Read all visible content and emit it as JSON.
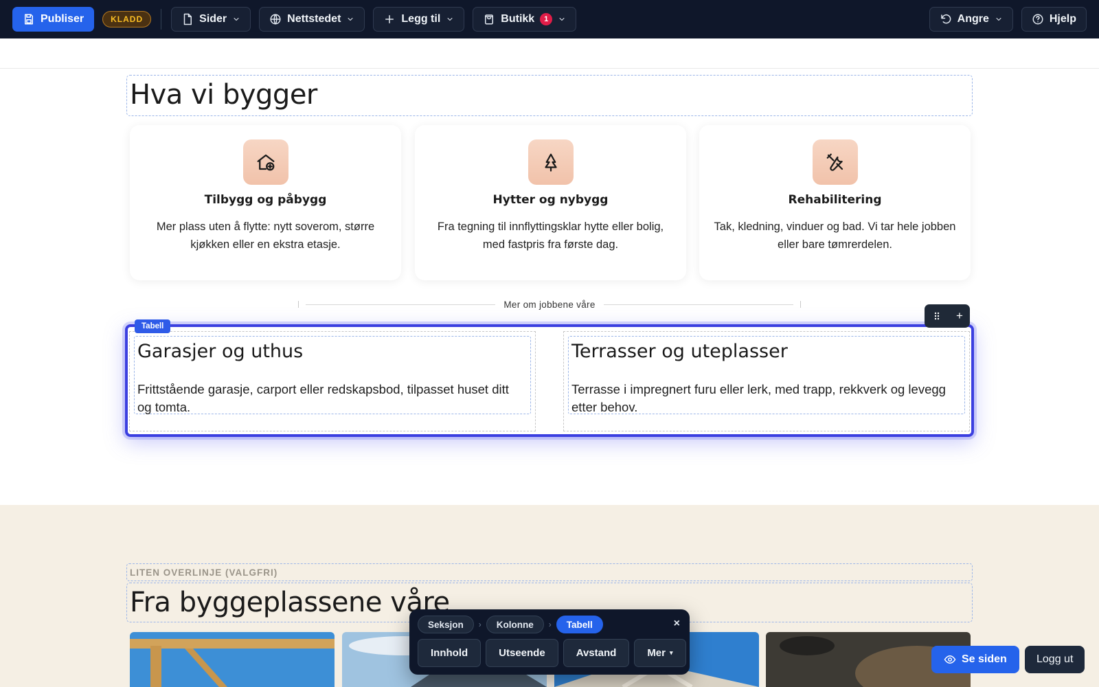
{
  "topbar": {
    "publish_label": "Publiser",
    "draft_badge": "KLADD",
    "pages_label": "Sider",
    "site_label": "Nettstedet",
    "add_label": "Legg til",
    "shop_label": "Butikk",
    "shop_count": "1",
    "undo_label": "Angre",
    "help_label": "Hjelp"
  },
  "section_services": {
    "heading": "Hva vi bygger",
    "cards": [
      {
        "icon": "house-plus-icon",
        "title": "Tilbygg og påbygg",
        "text": "Mer plass uten å flytte: nytt soverom, større kjøkken eller en ekstra etasje."
      },
      {
        "icon": "tree-icon",
        "title": "Hytter og nybygg",
        "text": "Fra tegning til innflyttingsklar hytte eller bolig, med fastpris fra første dag."
      },
      {
        "icon": "tools-icon",
        "title": "Rehabilitering",
        "text": "Tak, kledning, vinduer og bad. Vi tar hele jobben eller bare tømrerdelen."
      }
    ],
    "divider_label": "Mer om jobbene våre"
  },
  "selected_table": {
    "tag": "Tabell",
    "cells": [
      {
        "title": "Garasjer og uthus",
        "text": "Frittstående garasje, carport eller redskapsbod, tilpasset huset ditt og tomta."
      },
      {
        "title": "Terrasser og uteplasser",
        "text": "Terrasse i impregnert furu eller lerk, med trapp, rekkverk og levegg etter behov."
      }
    ]
  },
  "section_gallery": {
    "eyebrow": "LITEN OVERLINJE (VALGFRI)",
    "heading": "Fra byggeplassene våre"
  },
  "floating_bar": {
    "crumbs": [
      "Seksjon",
      "Kolonne",
      "Tabell"
    ],
    "close": "×",
    "actions": [
      "Innhold",
      "Utseende",
      "Avstand",
      "Mer"
    ],
    "more_caret": "▾"
  },
  "bottom": {
    "view_label": "Se siden",
    "logout_label": "Logg ut"
  },
  "colors": {
    "accent": "#2563eb",
    "selection": "#3b3fe0",
    "toolbar_bg": "#0f172a",
    "section_bg": "#f5efe4",
    "icon_tile": "#f3c9b3"
  }
}
